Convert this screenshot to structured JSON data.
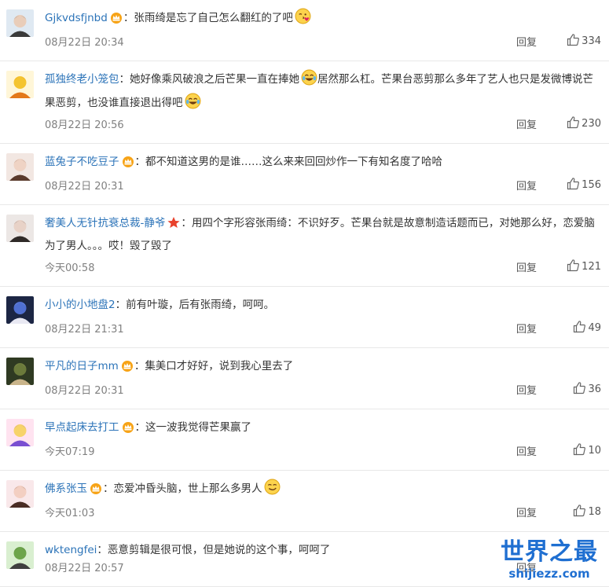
{
  "reply_label": "回复",
  "comments": [
    {
      "user": "Gjkvdsfjnbd",
      "badge": "crown",
      "text": "张雨绮是忘了自己怎么翻红的了吧",
      "emojis": [
        "heart-kiss-emoji"
      ],
      "time": "08月22日 20:34",
      "likes": "334"
    },
    {
      "user": "孤独终老小笼包",
      "badge": "",
      "text": "她好像乘风破浪之后芒果一直在捧她",
      "emojis": [
        "laugh-cry-emoji"
      ],
      "text2": "居然那么杠。芒果台恶剪那么多年了艺人也只是发微博说芒果恶剪，也没谁直接退出得吧",
      "emojis2": [
        "laugh-cry-emoji"
      ],
      "time": "08月22日 20:56",
      "likes": "230"
    },
    {
      "user": "蓝兔子不吃豆子",
      "badge": "crown",
      "text": "都不知道这男的是谁……这么来来回回炒作一下有知名度了哈哈",
      "time": "08月22日 20:31",
      "likes": "156"
    },
    {
      "user": "奢美人无针抗衰总裁-静爷",
      "badge": "star",
      "text": "用四个字形容张雨绮：不识好歹。芒果台就是故意制造话题而已，对她那么好，恋爱脑为了男人。。。哎！毁了毁了",
      "time": "今天00:58",
      "likes": "121"
    },
    {
      "user": "小小的小地盘2",
      "badge": "",
      "text": "前有叶璇，后有张雨绮，呵呵。",
      "time": "08月22日 21:31",
      "likes": "49"
    },
    {
      "user": "平凡的日子mm",
      "badge": "crown",
      "text": "集美口才好好，说到我心里去了",
      "time": "08月22日 20:31",
      "likes": "36"
    },
    {
      "user": "早点起床去打工",
      "badge": "crown",
      "text": "这一波我觉得芒果赢了",
      "time": "今天07:19",
      "likes": "10"
    },
    {
      "user": "佛系张玉",
      "badge": "crown",
      "text": "恋爱冲昏头脑，世上那么多男人",
      "emojis": [
        "smirk-emoji"
      ],
      "time": "今天01:03",
      "likes": "18"
    },
    {
      "user": "wktengfei",
      "badge": "",
      "text": "恶意剪辑是很可恨，但是她说的这个事，呵呵了",
      "time": "08月22日 20:57",
      "likes": ""
    }
  ],
  "watermark": {
    "cn": "世界之最",
    "en": "shijiezz.com"
  }
}
